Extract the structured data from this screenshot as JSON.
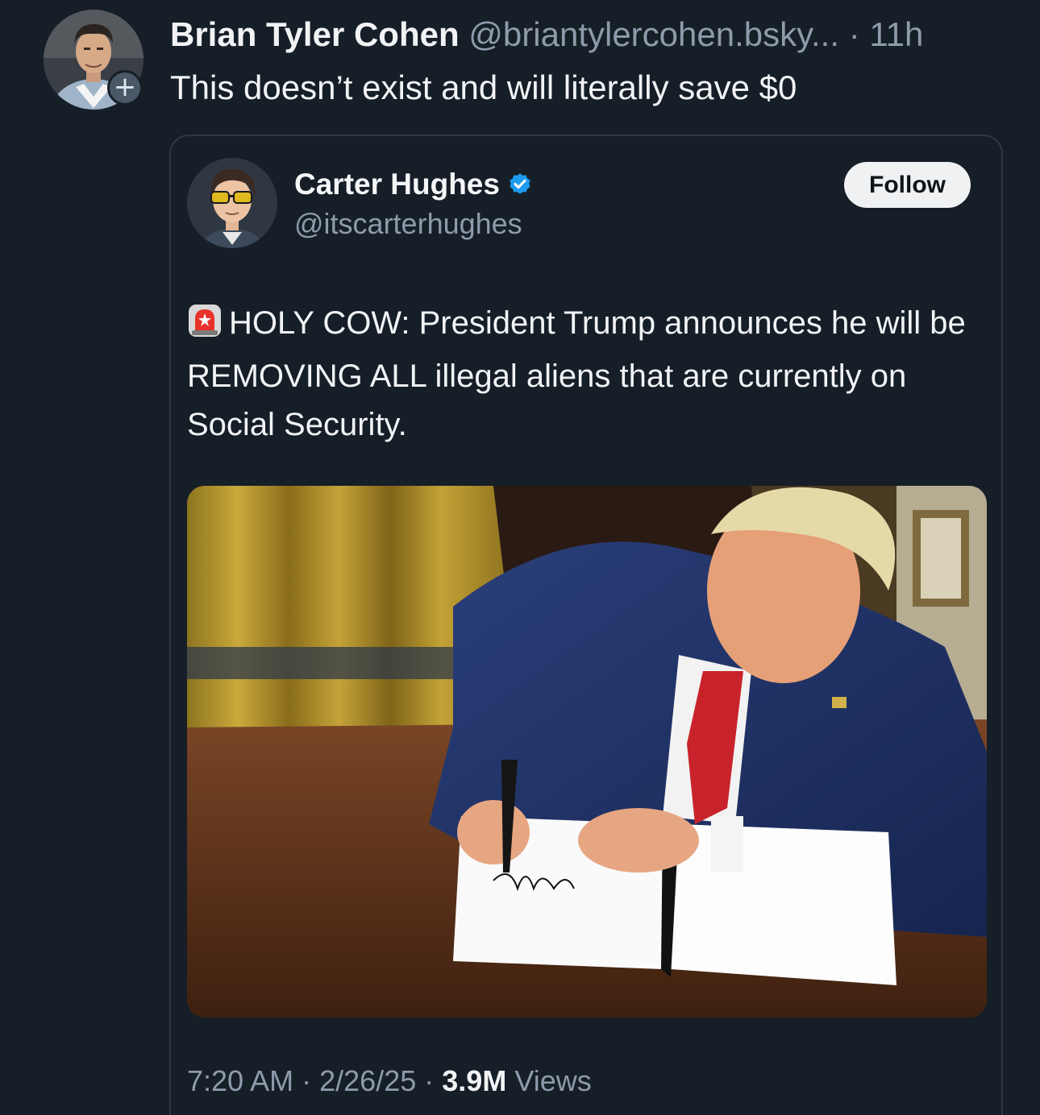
{
  "post": {
    "author_name": "Brian Tyler Cohen",
    "author_handle": "@briantylercohen.bsky...",
    "separator": "·",
    "time": "11h",
    "text": "This doesn’t exist and will literally save $0",
    "follow_icon": "plus-icon",
    "follow_symbol": "+"
  },
  "quote": {
    "author_name": "Carter Hughes",
    "author_handle": "@itscarterhughes",
    "verified_icon": "verified-badge-icon",
    "follow_label": "Follow",
    "emoji_icon": "rotating-light-icon",
    "text": "HOLY COW: President Trump announces he will be REMOVING ALL illegal aliens that are currently on Social Security.",
    "image": "photo-president-signing-document-at-desk",
    "meta": {
      "time": "7:20 AM",
      "sep1": "·",
      "date": "2/26/25",
      "sep2": "·",
      "views_count": "3.9M",
      "views_label": "Views"
    }
  },
  "colors": {
    "background": "#161e27",
    "text_primary": "#f1f3f5",
    "text_secondary": "#8e9bab",
    "border": "#2c3845",
    "verified": "#1d9bf0",
    "follow_button_bg": "#eff1f3"
  }
}
